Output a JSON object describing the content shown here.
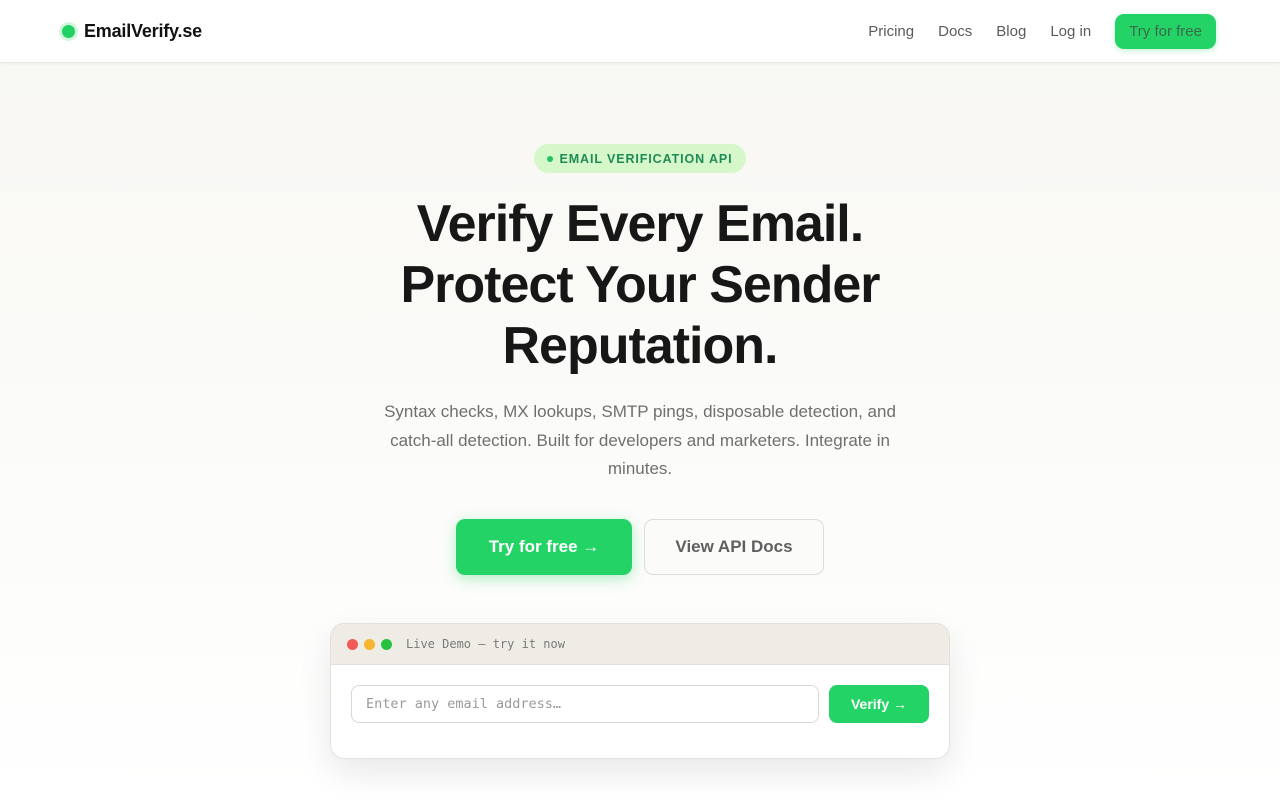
{
  "header": {
    "brand": "EmailVerify.se",
    "nav": [
      {
        "label": "Pricing"
      },
      {
        "label": "Docs"
      },
      {
        "label": "Blog"
      },
      {
        "label": "Log in"
      }
    ],
    "cta_label": "Try for free"
  },
  "hero": {
    "badge": "EMAIL VERIFICATION API",
    "title_lines": [
      "Verify Every Email.",
      "Protect Your Sender",
      "Reputation."
    ],
    "subtitle": "Syntax checks, MX lookups, SMTP pings, disposable detection, and catch-all detection. Built for developers and marketers. Integrate in minutes.",
    "primary_cta": "Try for free →",
    "secondary_cta": "View API Docs"
  },
  "demo": {
    "title": "Live Demo — try it now",
    "input_placeholder": "Enter any email address…",
    "input_value": "",
    "button_label": "Verify →",
    "window_dot_colors": [
      "#f25a57",
      "#f6b52e",
      "#27c340"
    ]
  },
  "colors": {
    "accent": "#24d366",
    "badge_bg": "#d6f7c9",
    "badge_text": "#1f8b57"
  },
  "icons": {
    "logo": "status-dot-icon",
    "badge": "status-dot-icon",
    "window_controls": [
      "close-dot-icon",
      "minimize-dot-icon",
      "maximize-dot-icon"
    ]
  }
}
